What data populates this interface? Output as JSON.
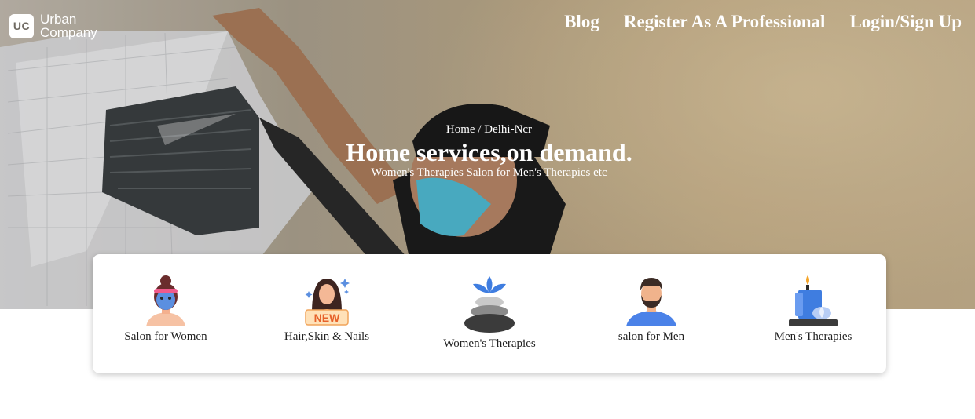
{
  "brand": {
    "logo_mark": "UC",
    "name_line1": "Urban",
    "name_line2": "Company"
  },
  "nav": {
    "items": [
      "Blog",
      "Register As A Professional",
      "Login/Sign Up"
    ]
  },
  "hero": {
    "breadcrumb": "Home / Delhi-Ncr",
    "title": "Home services,on demand.",
    "subtitle": "Women's Therapies Salon for Men's Therapies etc"
  },
  "categories": [
    {
      "label": "Salon for Women",
      "icon": "woman-facemask-icon"
    },
    {
      "label": "Hair,Skin & Nails",
      "icon": "woman-new-icon",
      "badge": "NEW"
    },
    {
      "label": "Women's Therapies",
      "icon": "spa-stones-icon"
    },
    {
      "label": "salon for Men",
      "icon": "man-avatar-icon"
    },
    {
      "label": "Men's Therapies",
      "icon": "candle-lotus-icon"
    }
  ],
  "colors": {
    "accent_text": "#ffffff",
    "card_bg": "#ffffff",
    "body_text": "#222222"
  }
}
